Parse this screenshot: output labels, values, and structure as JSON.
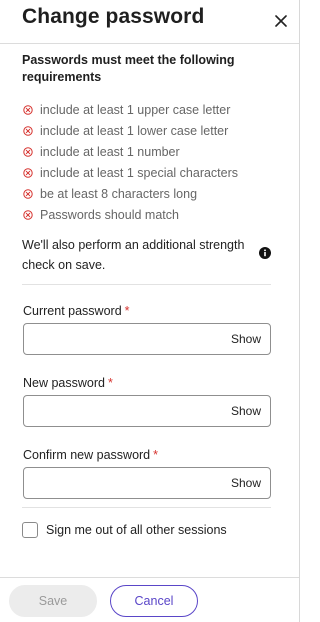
{
  "header": {
    "title": "Change password"
  },
  "requirements": {
    "title": "Passwords must meet the following requirements",
    "rules": [
      "include at least 1 upper case letter",
      "include at least 1 lower case letter",
      "include at least 1 number",
      "include at least 1 special characters",
      "be at least 8 characters long",
      "Passwords should match"
    ],
    "rule_status_color": "#d6322e"
  },
  "strength_note": "We'll also perform an additional strength check on save.",
  "fields": {
    "current": {
      "label": "Current password",
      "required_mark": "*",
      "value": "",
      "show_label": "Show"
    },
    "new": {
      "label": "New password",
      "required_mark": "*",
      "value": "",
      "show_label": "Show"
    },
    "confirm": {
      "label": "Confirm new password",
      "required_mark": "*",
      "value": "",
      "show_label": "Show"
    }
  },
  "signout": {
    "label": "Sign me out of all other sessions",
    "checked": false
  },
  "footer": {
    "save_label": "Save",
    "cancel_label": "Cancel"
  },
  "colors": {
    "accent": "#5a46c8",
    "required": "#d6322e",
    "disabled_bg": "#ececec"
  }
}
